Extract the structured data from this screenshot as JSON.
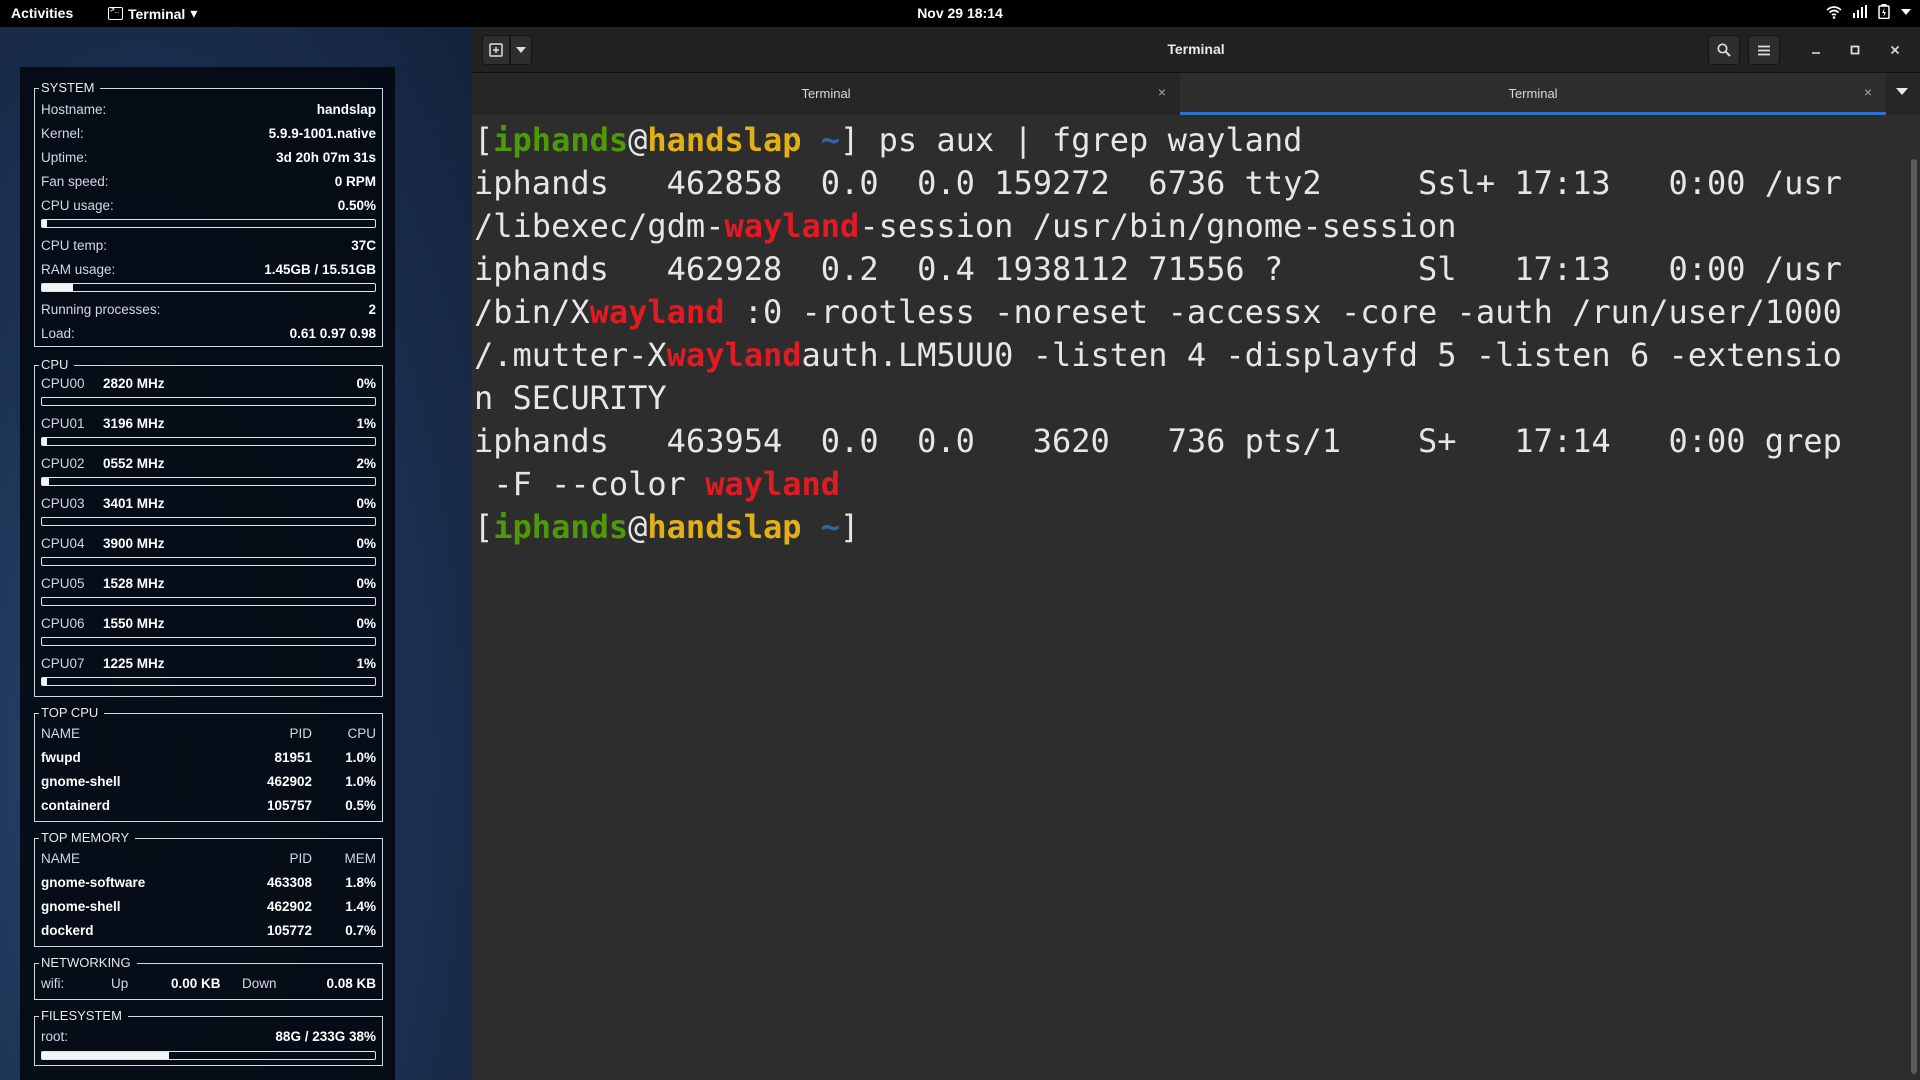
{
  "topbar": {
    "activities": "Activities",
    "app_name": "Terminal",
    "app_arrow": "▾",
    "datetime": "Nov 29  18:14",
    "tray_icons": [
      "wifi-icon",
      "volume-icon",
      "battery-icon",
      "system-menu-icon"
    ]
  },
  "conky": {
    "system": {
      "title": "SYSTEM",
      "hostname_label": "Hostname:",
      "hostname": "handslap",
      "kernel_label": "Kernel:",
      "kernel": "5.9.9-1001.native",
      "uptime_label": "Uptime:",
      "uptime": "3d 20h 07m 31s",
      "fan_label": "Fan speed:",
      "fan": "0 RPM",
      "cpu_usage_label": "CPU usage:",
      "cpu_usage": "0.50%",
      "cpu_usage_frac": 0.005,
      "cpu_temp_label": "CPU temp:",
      "cpu_temp": "37C",
      "ram_label": "RAM usage:",
      "ram": "1.45GB / 15.51GB",
      "ram_frac": 0.094,
      "procs_label": "Running processes:",
      "procs": "2",
      "load_label": "Load:",
      "load": "0.61 0.97 0.98"
    },
    "cpu": {
      "title": "CPU",
      "cores": [
        {
          "name": "CPU00",
          "mhz": "2820 MHz",
          "pct": "0%",
          "frac": 0.0
        },
        {
          "name": "CPU01",
          "mhz": "3196 MHz",
          "pct": "1%",
          "frac": 0.01
        },
        {
          "name": "CPU02",
          "mhz": "0552 MHz",
          "pct": "2%",
          "frac": 0.02
        },
        {
          "name": "CPU03",
          "mhz": "3401 MHz",
          "pct": "0%",
          "frac": 0.0
        },
        {
          "name": "CPU04",
          "mhz": "3900 MHz",
          "pct": "0%",
          "frac": 0.0
        },
        {
          "name": "CPU05",
          "mhz": "1528 MHz",
          "pct": "0%",
          "frac": 0.0
        },
        {
          "name": "CPU06",
          "mhz": "1550 MHz",
          "pct": "0%",
          "frac": 0.0
        },
        {
          "name": "CPU07",
          "mhz": "1225 MHz",
          "pct": "1%",
          "frac": 0.01
        }
      ]
    },
    "top_cpu": {
      "title": "TOP CPU",
      "headers": [
        "NAME",
        "PID",
        "CPU"
      ],
      "rows": [
        [
          "fwupd",
          "81951",
          "1.0%"
        ],
        [
          "gnome-shell",
          "462902",
          "1.0%"
        ],
        [
          "containerd",
          "105757",
          "0.5%"
        ]
      ]
    },
    "top_memory": {
      "title": "TOP MEMORY",
      "headers": [
        "NAME",
        "PID",
        "MEM"
      ],
      "rows": [
        [
          "gnome-software",
          "463308",
          "1.8%"
        ],
        [
          "gnome-shell",
          "462902",
          "1.4%"
        ],
        [
          "dockerd",
          "105772",
          "0.7%"
        ]
      ]
    },
    "networking": {
      "title": "NETWORKING",
      "iface": "wifi:",
      "up_label": "Up",
      "up": "0.00 KB",
      "down_label": "Down",
      "down": "0.08 KB"
    },
    "filesystem": {
      "title": "FILESYSTEM",
      "mount": "root:",
      "usage": "88G / 233G 38%",
      "frac": 0.38
    }
  },
  "window": {
    "title": "Terminal",
    "tabs": [
      {
        "label": "Terminal",
        "close": "×",
        "active": false
      },
      {
        "label": "Terminal",
        "close": "×",
        "active": true
      }
    ]
  },
  "terminal": {
    "lines": [
      [
        [
          "[",
          ""
        ],
        [
          "iphands",
          "green"
        ],
        [
          "@",
          ""
        ],
        [
          "handslap",
          "yellow"
        ],
        [
          " ",
          ""
        ],
        [
          "~",
          "blue"
        ],
        [
          "] ps aux | fgrep wayland",
          ""
        ]
      ],
      [
        [
          "iphands   462858  0.0  0.0 159272  6736 tty2     Ssl+ 17:13   0:00 /usr",
          ""
        ]
      ],
      [
        [
          "/libexec/gdm-",
          ""
        ],
        [
          "wayland",
          "red"
        ],
        [
          "-session /usr/bin/gnome-session",
          ""
        ]
      ],
      [
        [
          "iphands   462928  0.2  0.4 1938112 71556 ?       Sl   17:13   0:00 /usr",
          ""
        ]
      ],
      [
        [
          "/bin/X",
          ""
        ],
        [
          "wayland",
          "red"
        ],
        [
          " :0 -rootless -noreset -accessx -core -auth /run/user/1000",
          ""
        ]
      ],
      [
        [
          "/.mutter-X",
          ""
        ],
        [
          "wayland",
          "red"
        ],
        [
          "auth.LM5UU0 -listen 4 -displayfd 5 -listen 6 -extensio",
          ""
        ]
      ],
      [
        [
          "n SECURITY",
          ""
        ]
      ],
      [
        [
          "iphands   463954  0.0  0.0   3620   736 pts/1    S+   17:14   0:00 grep",
          ""
        ]
      ],
      [
        [
          " -F --color ",
          ""
        ],
        [
          "wayland",
          "red"
        ]
      ],
      [
        [
          "[",
          ""
        ],
        [
          "iphands",
          "green"
        ],
        [
          "@",
          ""
        ],
        [
          "handslap",
          "yellow"
        ],
        [
          " ",
          ""
        ],
        [
          "~",
          "blue"
        ],
        [
          "]",
          ""
        ]
      ]
    ]
  }
}
